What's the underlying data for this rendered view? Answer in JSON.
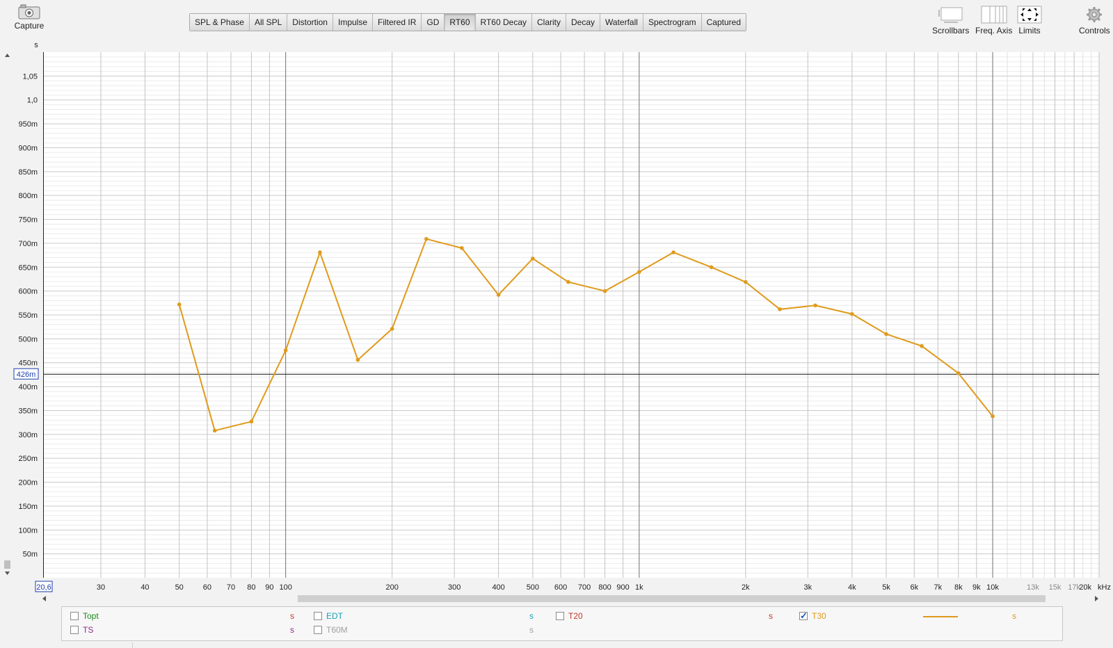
{
  "capture": {
    "label": "Capture"
  },
  "tabs": [
    {
      "label": "SPL & Phase",
      "active": false
    },
    {
      "label": "All SPL",
      "active": false
    },
    {
      "label": "Distortion",
      "active": false
    },
    {
      "label": "Impulse",
      "active": false
    },
    {
      "label": "Filtered IR",
      "active": false
    },
    {
      "label": "GD",
      "active": false
    },
    {
      "label": "RT60",
      "active": true
    },
    {
      "label": "RT60 Decay",
      "active": false
    },
    {
      "label": "Clarity",
      "active": false
    },
    {
      "label": "Decay",
      "active": false
    },
    {
      "label": "Waterfall",
      "active": false
    },
    {
      "label": "Spectrogram",
      "active": false
    },
    {
      "label": "Captured",
      "active": false
    }
  ],
  "toolbar": {
    "scrollbars": "Scrollbars",
    "freq_axis": "Freq. Axis",
    "limits": "Limits",
    "controls": "Controls"
  },
  "axes": {
    "y_unit": "s",
    "x_left_readout": "20,6",
    "cursor_readout": "426m",
    "x_unit": "kHz"
  },
  "chart_data": {
    "type": "line",
    "xscale": "log",
    "xlim": [
      20.6,
      20000
    ],
    "ylim": [
      0,
      1.1
    ],
    "grid": true,
    "cursor_y": 0.426,
    "y_ticks": [
      {
        "v": 0.05,
        "label": "50m"
      },
      {
        "v": 0.1,
        "label": "100m"
      },
      {
        "v": 0.15,
        "label": "150m"
      },
      {
        "v": 0.2,
        "label": "200m"
      },
      {
        "v": 0.25,
        "label": "250m"
      },
      {
        "v": 0.3,
        "label": "300m"
      },
      {
        "v": 0.35,
        "label": "350m"
      },
      {
        "v": 0.4,
        "label": "400m"
      },
      {
        "v": 0.45,
        "label": "450m"
      },
      {
        "v": 0.5,
        "label": "500m"
      },
      {
        "v": 0.55,
        "label": "550m"
      },
      {
        "v": 0.6,
        "label": "600m"
      },
      {
        "v": 0.65,
        "label": "650m"
      },
      {
        "v": 0.7,
        "label": "700m"
      },
      {
        "v": 0.75,
        "label": "750m"
      },
      {
        "v": 0.8,
        "label": "800m"
      },
      {
        "v": 0.85,
        "label": "850m"
      },
      {
        "v": 0.9,
        "label": "900m"
      },
      {
        "v": 0.95,
        "label": "950m"
      },
      {
        "v": 1.0,
        "label": "1,0"
      },
      {
        "v": 1.05,
        "label": "1,05"
      }
    ],
    "x_ticks": [
      {
        "v": 30,
        "label": "30"
      },
      {
        "v": 40,
        "label": "40"
      },
      {
        "v": 50,
        "label": "50"
      },
      {
        "v": 60,
        "label": "60"
      },
      {
        "v": 70,
        "label": "70"
      },
      {
        "v": 80,
        "label": "80"
      },
      {
        "v": 90,
        "label": "90"
      },
      {
        "v": 100,
        "label": "100"
      },
      {
        "v": 200,
        "label": "200"
      },
      {
        "v": 300,
        "label": "300"
      },
      {
        "v": 400,
        "label": "400"
      },
      {
        "v": 500,
        "label": "500"
      },
      {
        "v": 600,
        "label": "600"
      },
      {
        "v": 700,
        "label": "700"
      },
      {
        "v": 800,
        "label": "800"
      },
      {
        "v": 900,
        "label": "900"
      },
      {
        "v": 1000,
        "label": "1k"
      },
      {
        "v": 2000,
        "label": "2k"
      },
      {
        "v": 3000,
        "label": "3k"
      },
      {
        "v": 4000,
        "label": "4k"
      },
      {
        "v": 5000,
        "label": "5k"
      },
      {
        "v": 6000,
        "label": "6k"
      },
      {
        "v": 7000,
        "label": "7k"
      },
      {
        "v": 8000,
        "label": "8k"
      },
      {
        "v": 9000,
        "label": "9k"
      },
      {
        "v": 10000,
        "label": "10k"
      },
      {
        "v": 13000,
        "label": "13k",
        "dim": true
      },
      {
        "v": 15000,
        "label": "15k",
        "dim": true
      },
      {
        "v": 17000,
        "label": "17k",
        "dim": true
      },
      {
        "v": 20000,
        "label": "20k",
        "dim": true
      }
    ],
    "series": [
      {
        "name": "T30",
        "color": "#e09a1a",
        "x": [
          50,
          63,
          80,
          100,
          125,
          160,
          200,
          250,
          315,
          400,
          500,
          630,
          800,
          1000,
          1250,
          1600,
          2000,
          2500,
          3150,
          4000,
          5000,
          6300,
          8000,
          10000
        ],
        "y": [
          0.572,
          0.308,
          0.327,
          0.476,
          0.681,
          0.456,
          0.521,
          0.709,
          0.69,
          0.592,
          0.668,
          0.619,
          0.6,
          0.64,
          0.681,
          0.65,
          0.619,
          0.562,
          0.57,
          0.552,
          0.51,
          0.485,
          0.428,
          0.338
        ]
      }
    ]
  },
  "legend": [
    {
      "label": "Topt",
      "unit": "s",
      "checked": false,
      "color": "#1a8a1a",
      "unit_color": "#c0392b"
    },
    {
      "label": "EDT",
      "unit": "s",
      "checked": false,
      "color": "#1aa0b8",
      "unit_color": "#1aa0b8"
    },
    {
      "label": "T20",
      "unit": "s",
      "checked": false,
      "color": "#c0392b",
      "unit_color": "#c0392b"
    },
    {
      "label": "T30",
      "unit": "s",
      "checked": true,
      "color": "#e09a1a",
      "unit_color": "#e09a1a"
    },
    {
      "label": "TS",
      "unit": "s",
      "checked": false,
      "color": "#8e2a8e",
      "unit_color": "#8e2a8e"
    },
    {
      "label": "T60M",
      "unit": "s",
      "checked": false,
      "color": "#a0a0a0",
      "unit_color": "#a0a0a0"
    }
  ]
}
